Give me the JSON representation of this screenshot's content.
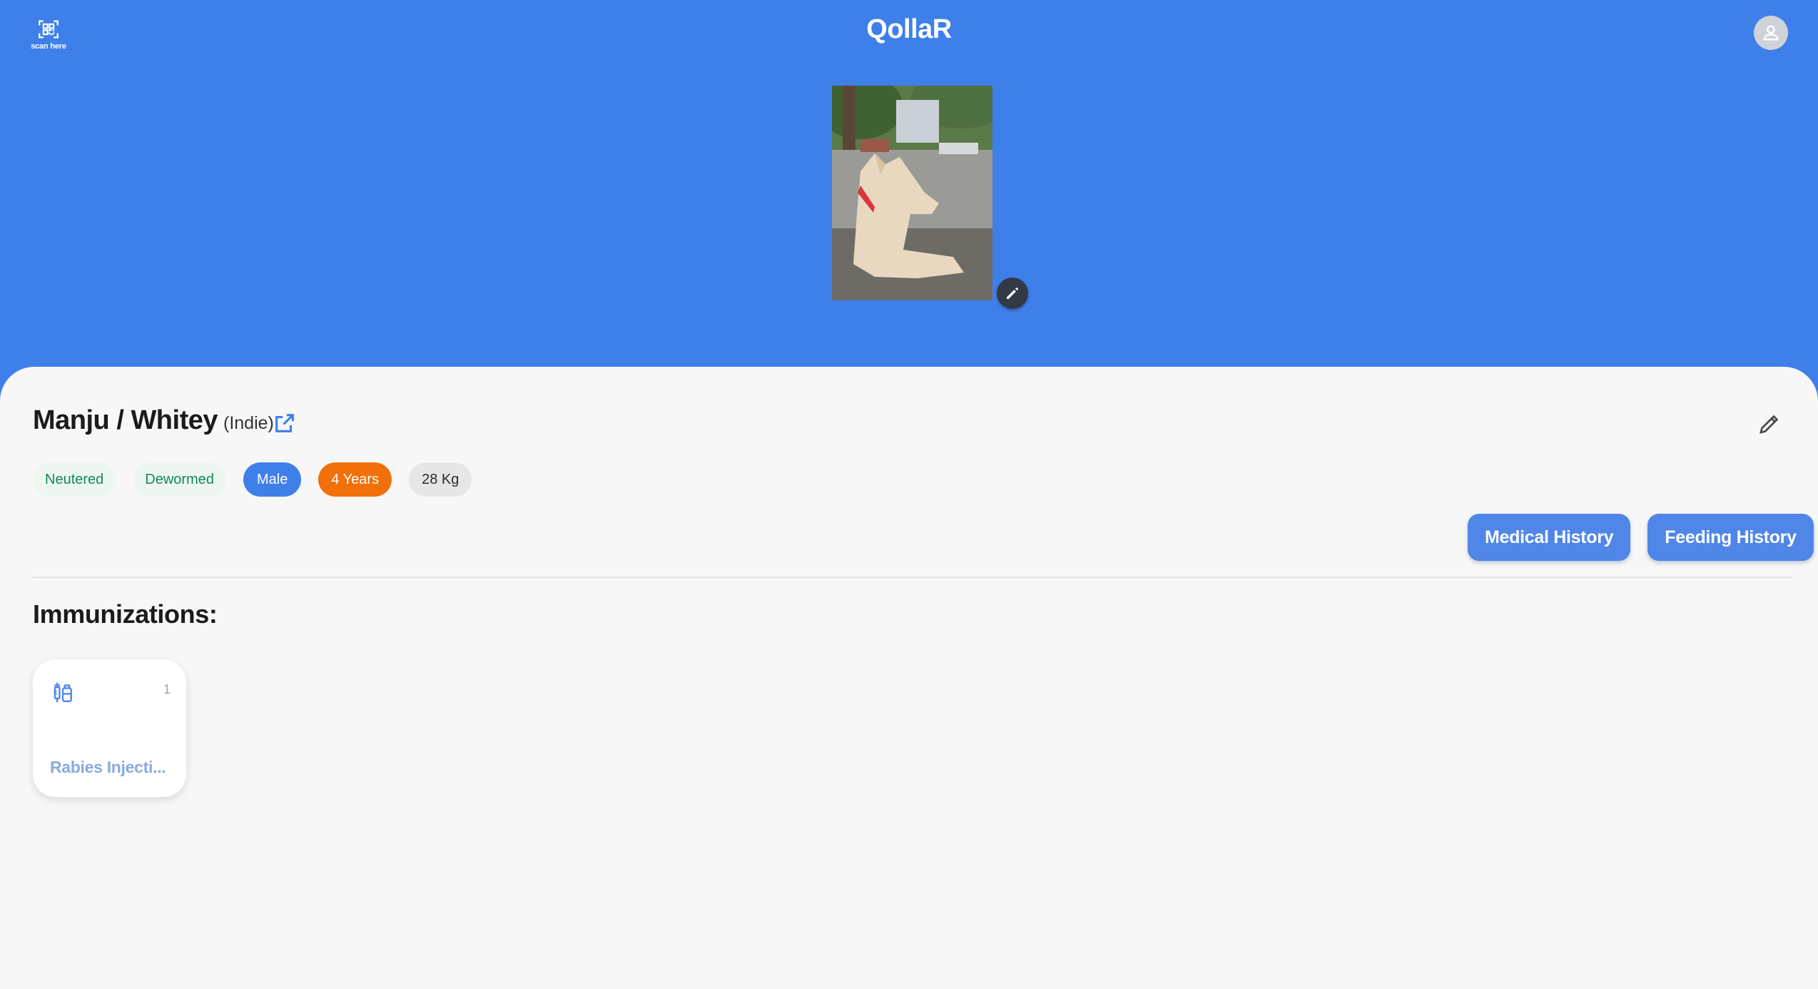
{
  "header": {
    "scan_label": "scan here",
    "scan_icon": "qr-scan-icon",
    "app_title": "QollaR",
    "avatar_icon": "user-icon",
    "brand_color": "#3f7fea"
  },
  "pet": {
    "photo_alt": "Pet photo",
    "name": "Manju / Whitey",
    "breed": "(Indie)",
    "tags": [
      {
        "label": "Neutered",
        "style": "green"
      },
      {
        "label": "Dewormed",
        "style": "green"
      },
      {
        "label": "Male",
        "style": "blue"
      },
      {
        "label": "4 Years",
        "style": "orange"
      },
      {
        "label": "28 Kg",
        "style": "grey"
      }
    ]
  },
  "actions": {
    "medical_history": "Medical History",
    "feeding_history": "Feeding History"
  },
  "immunizations": {
    "title": "Immunizations:",
    "items": [
      {
        "icon": "syringe-icon",
        "count": "1",
        "name": "Rabies Injecti..."
      }
    ]
  }
}
